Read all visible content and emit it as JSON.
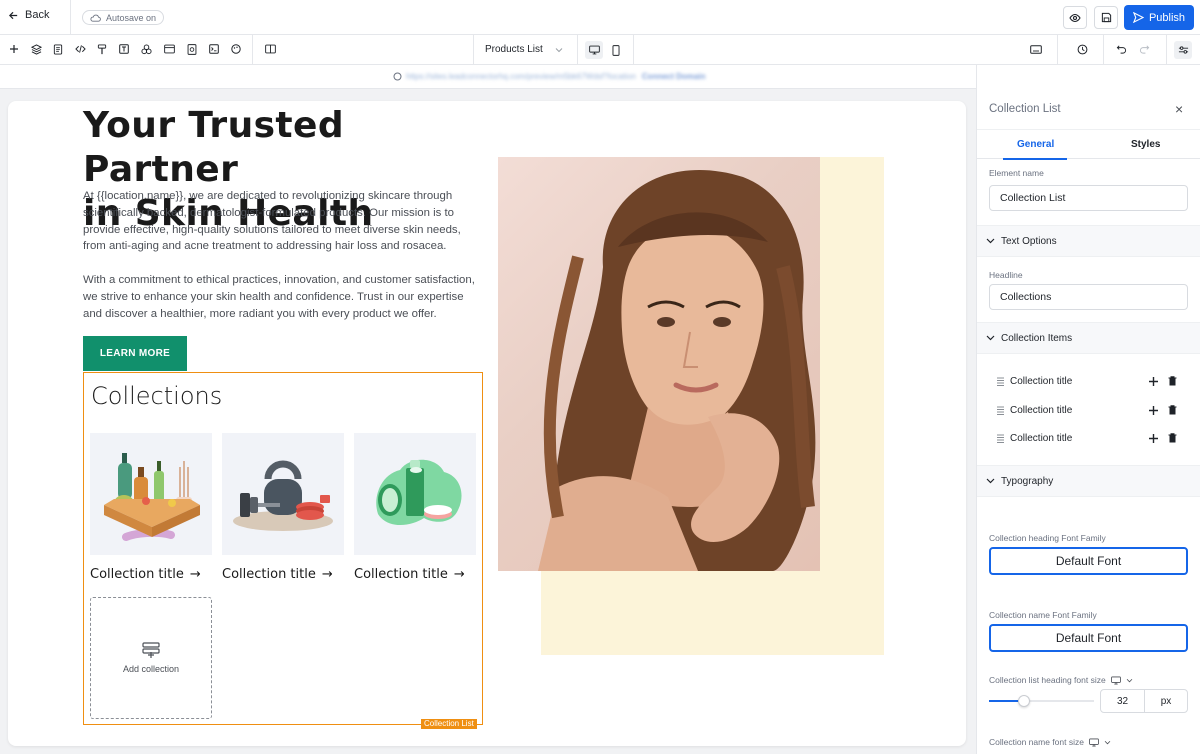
{
  "topbar": {
    "back_label": "Back",
    "autosave_label": "Autosave on",
    "publish_label": "Publish"
  },
  "toolbar": {
    "page_select": "Products List"
  },
  "url_bar": {
    "url_text": "https://sites.leadconnectorhq.com/preview/m5bk67Wdsf?location",
    "link_text": "Connect Domain"
  },
  "hero": {
    "headline_line1": "Your Trusted Partner",
    "headline_line2": "in Skin Health",
    "paragraph1": "At {{location.name}}, we are dedicated to revolutionizing skincare through scientifically backed, dermatologist-formulated products. Our mission is to provide effective, high-quality solutions tailored to meet diverse skin needs, from anti-aging and acne treatment to addressing hair loss and rosacea.",
    "paragraph2": "With a commitment to ethical practices, innovation, and customer satisfaction, we strive to enhance your skin health and confidence. Trust in our expertise and discover a healthier, more radiant you with every product we offer.",
    "cta_label": "LEARN MORE"
  },
  "collections": {
    "heading": "Collections",
    "items": [
      {
        "title": "Collection title",
        "arrow": "→"
      },
      {
        "title": "Collection title",
        "arrow": "→"
      },
      {
        "title": "Collection title",
        "arrow": "→"
      }
    ],
    "add_label": "Add collection",
    "tag_label": "Collection List"
  },
  "panel": {
    "title": "Collection List",
    "close_icon": "×",
    "tabs": [
      "General",
      "Styles"
    ],
    "element_name_label": "Element name",
    "element_name_value": "Collection List",
    "text_options_label": "Text Options",
    "headline_label": "Headline",
    "headline_value": "Collections",
    "collection_items_label": "Collection Items",
    "collection_items": [
      "Collection title",
      "Collection title",
      "Collection title"
    ],
    "typography_label": "Typography",
    "heading_font_label": "Collection heading Font Family",
    "heading_font_value": "Default Font",
    "name_font_label": "Collection name Font Family",
    "name_font_value": "Default Font",
    "heading_size_label": "Collection list heading font size",
    "heading_size_value": "32",
    "heading_size_unit": "px",
    "name_size_label": "Collection name font size"
  },
  "colors": {
    "accent": "#1565e8",
    "cta": "#11906c",
    "selection": "#ef8f12"
  }
}
